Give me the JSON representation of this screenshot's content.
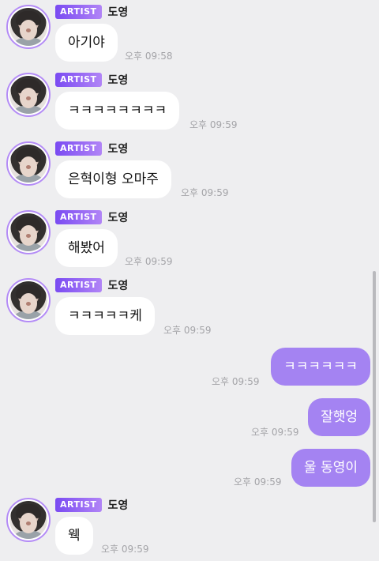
{
  "badge_label": "ARTIST",
  "colors": {
    "accent": "#a483f2",
    "badge_start": "#7a4bf2",
    "badge_end": "#b184f6",
    "background": "#eeeef0"
  },
  "incoming": [
    {
      "sender": "도영",
      "text": "아기야",
      "time": "오후 09:58"
    },
    {
      "sender": "도영",
      "text": "ㅋㅋㅋㅋㅋㅋㅋㅋ",
      "time": "오후 09:59"
    },
    {
      "sender": "도영",
      "text": "은혁이형 오마주",
      "time": "오후 09:59"
    },
    {
      "sender": "도영",
      "text": "해봤어",
      "time": "오후 09:59"
    },
    {
      "sender": "도영",
      "text": "ㅋㅋㅋㅋㅋ케",
      "time": "오후 09:59"
    },
    {
      "sender": "도영",
      "text": "웩",
      "time": "오후 09:59"
    }
  ],
  "outgoing": [
    {
      "text": "ㅋㅋㅋㅋㅋㅋ",
      "time": "오후 09:59"
    },
    {
      "text": "잘햇엉",
      "time": "오후 09:59"
    },
    {
      "text": "울 동영이",
      "time": "오후 09:59"
    }
  ]
}
